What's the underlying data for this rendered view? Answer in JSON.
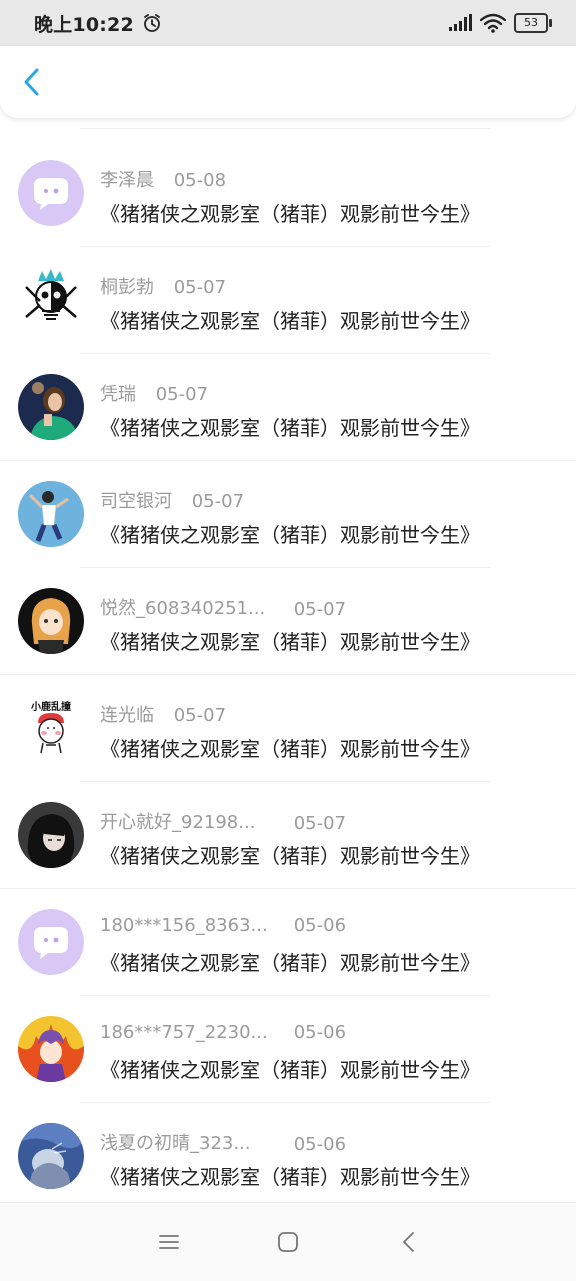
{
  "status_bar": {
    "time": "晚上10:22",
    "battery": "53"
  },
  "header": {
    "back_icon": "chevron-left-icon",
    "accent": "#2aa7e8"
  },
  "items": [
    {
      "name": "李泽晨",
      "date": "05-08",
      "title": "《猪猪侠之观影室（猪菲）观影前世今生》",
      "avatar": "chat-bubble-avatar"
    },
    {
      "name": "桐彭勃",
      "date": "05-07",
      "title": "《猪猪侠之观影室（猪菲）观影前世今生》",
      "avatar": "skull-cartoon-avatar"
    },
    {
      "name": "凭瑞",
      "date": "05-07",
      "title": "《猪猪侠之观影室（猪菲）观影前世今生》",
      "avatar": "girl-photo-avatar"
    },
    {
      "name": "司空银河",
      "date": "05-07",
      "title": "《猪猪侠之观影室（猪菲）观影前世今生》",
      "avatar": "dancer-photo-avatar"
    },
    {
      "name": "悦然_608340251...",
      "date": "05-07",
      "title": "《猪猪侠之观影室（猪菲）观影前世今生》",
      "avatar": "anime-girl-avatar"
    },
    {
      "name": "连光临",
      "date": "05-07",
      "title": "《猪猪侠之观影室（猪菲）观影前世今生》",
      "avatar": "deer-sticker-avatar",
      "sticker_text": "小鹿乱撞"
    },
    {
      "name": "开心就好_92198...",
      "date": "05-07",
      "title": "《猪猪侠之观影室（猪菲）观影前世今生》",
      "avatar": "dark-anime-avatar"
    },
    {
      "name": "180***156_8363...",
      "date": "05-06",
      "title": "《猪猪侠之观影室（猪菲）观影前世今生》",
      "avatar": "chat-bubble-avatar"
    },
    {
      "name": "186***757_2230...",
      "date": "05-06",
      "title": "《猪猪侠之观影室（猪菲）观影前世今生》",
      "avatar": "anime-flame-avatar"
    },
    {
      "name": "浅夏の初晴_323...",
      "date": "05-06",
      "title": "《猪猪侠之观影室（猪菲）观影前世今生》",
      "avatar": "blue-art-avatar"
    }
  ],
  "nav_bar": {
    "menu_icon": "menu-icon",
    "home_icon": "home-square-icon",
    "back_icon": "back-triangle-icon"
  }
}
